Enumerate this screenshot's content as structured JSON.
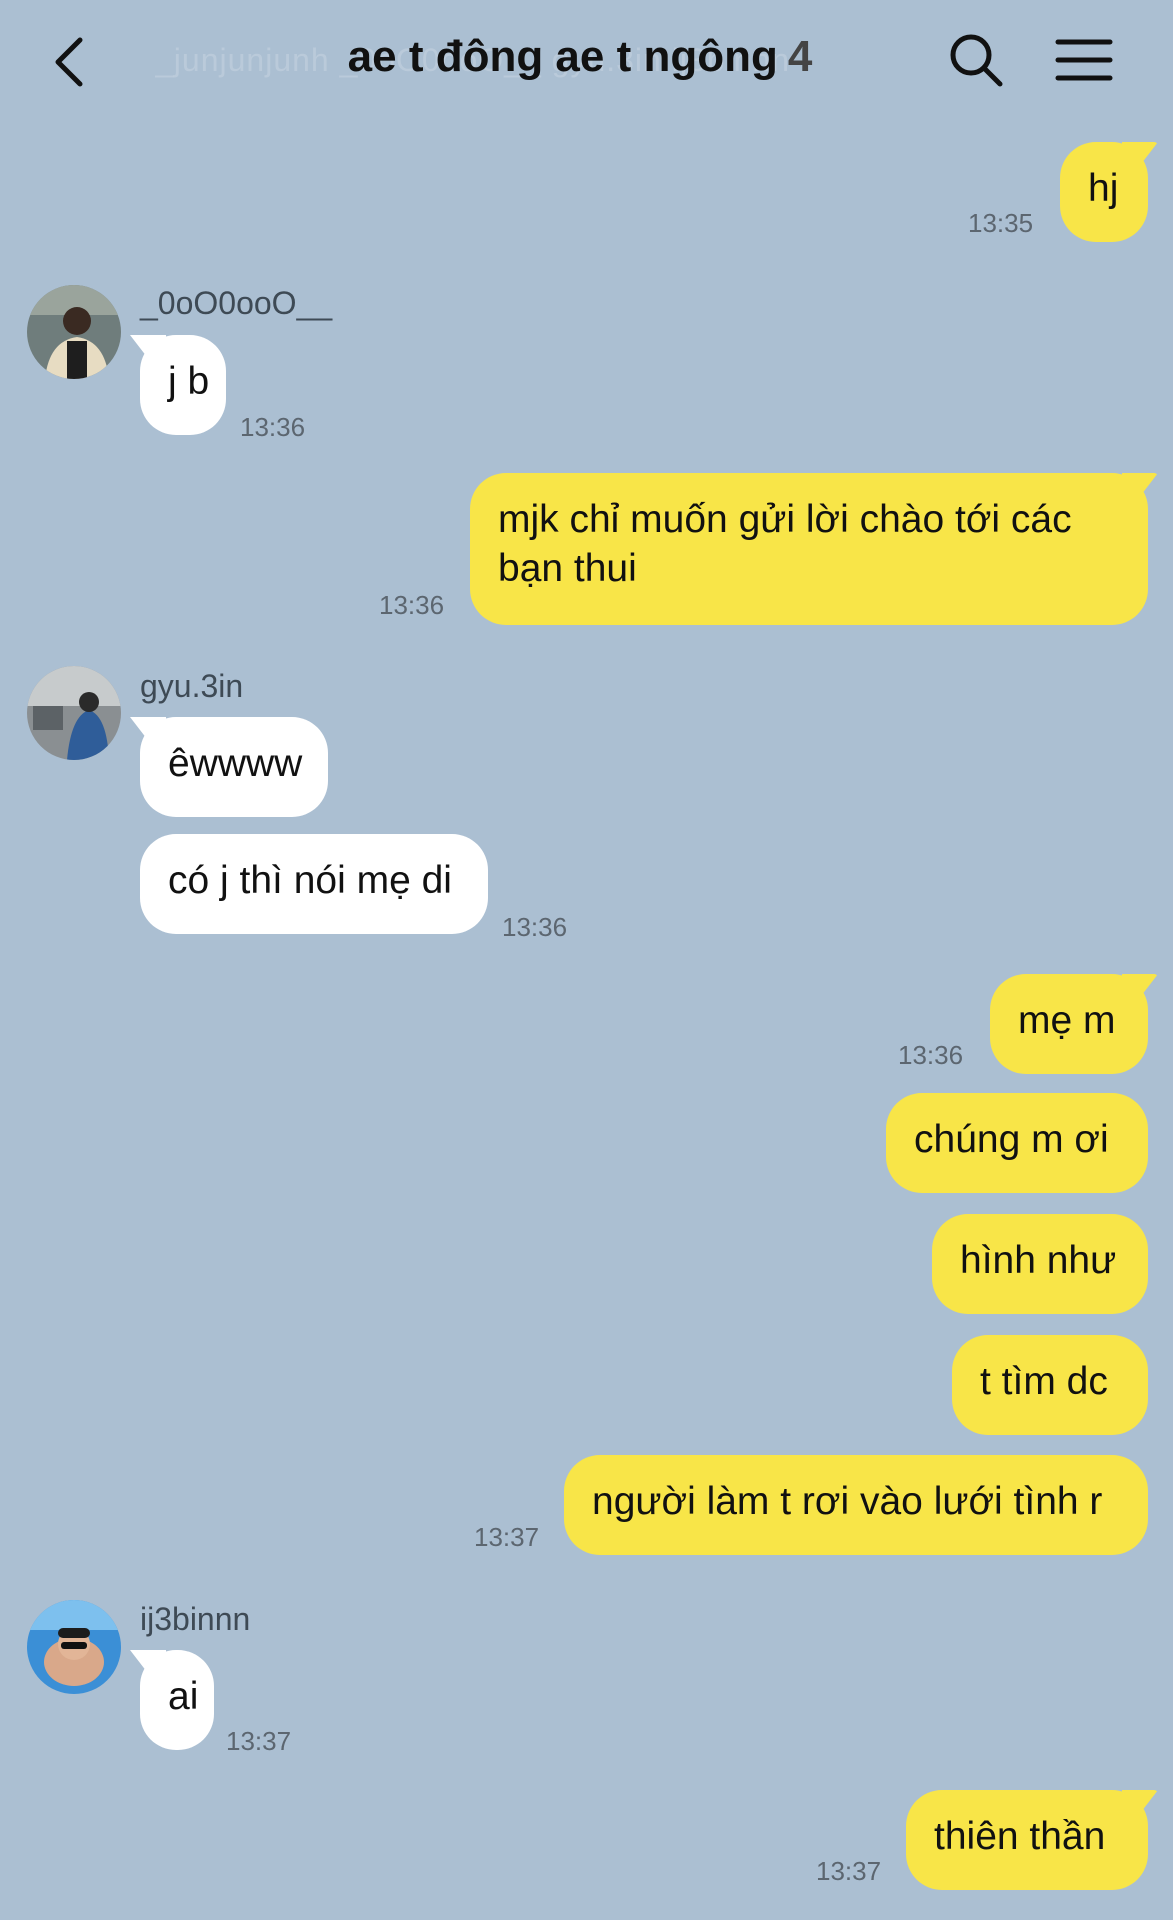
{
  "header": {
    "faint_names": "_junjunjunh     _0oO0ooO__     gyu.3in     ij3binnn",
    "title": "ae t đông ae t ngông",
    "member_count": "4"
  },
  "messages": [
    {
      "text": "hj",
      "time": "13:35"
    },
    {
      "sender": "_0oO0ooO__",
      "text": "j b",
      "time": "13:36"
    },
    {
      "text_line1": "mjk chỉ muốn gửi lời chào tới các",
      "text_line2": "bạn thui",
      "time": "13:36"
    },
    {
      "sender": "gyu.3in",
      "text": "êwwww"
    },
    {
      "text": "có j thì nói mẹ di",
      "time": "13:36"
    },
    {
      "text": "mẹ m",
      "time": "13:36"
    },
    {
      "text": "chúng m ơi"
    },
    {
      "text": "hình như"
    },
    {
      "text": "t tìm dc"
    },
    {
      "text": "người làm t rơi vào lưới tình r",
      "time": "13:37"
    },
    {
      "sender": "ij3binnn",
      "text": "ai",
      "time": "13:37"
    },
    {
      "text": "thiên thần",
      "time": "13:37"
    }
  ],
  "colors": {
    "background": "#abbfd2",
    "my_bubble": "#f8e548",
    "their_bubble": "#ffffff"
  },
  "icons": [
    "back-chevron-icon",
    "search-icon",
    "menu-icon"
  ]
}
